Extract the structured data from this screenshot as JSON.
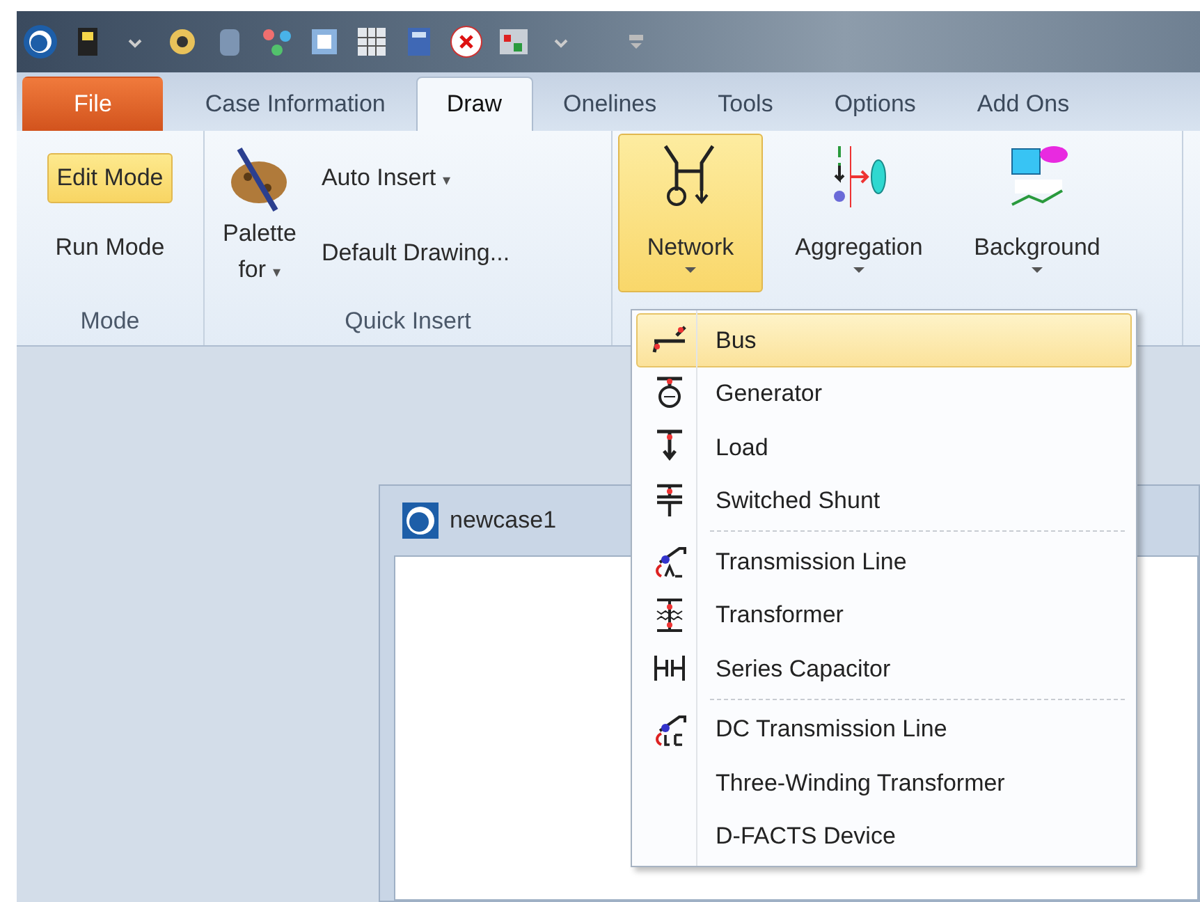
{
  "tabs": [
    {
      "label": "File",
      "kind": "file",
      "selected": false
    },
    {
      "label": "Case Information",
      "kind": "tab",
      "selected": false
    },
    {
      "label": "Draw",
      "kind": "tab",
      "selected": true
    },
    {
      "label": "Onelines",
      "kind": "tab",
      "selected": false
    },
    {
      "label": "Tools",
      "kind": "tab",
      "selected": false
    },
    {
      "label": "Options",
      "kind": "tab",
      "selected": false
    },
    {
      "label": "Add Ons",
      "kind": "tab",
      "selected": false
    }
  ],
  "ribbon": {
    "mode_group": {
      "label": "Mode",
      "buttons": [
        {
          "label": "Edit Mode",
          "selected": true
        },
        {
          "label": "Run Mode",
          "selected": false
        }
      ]
    },
    "quick_insert_group": {
      "label": "Quick Insert",
      "palette_button": {
        "label": "Palette",
        "label_2": "for",
        "caret": "▾"
      },
      "buttons": [
        {
          "label": "Auto Insert",
          "caret": "▾"
        },
        {
          "label": "Default Drawing..."
        }
      ]
    },
    "insert_group": {
      "buttons": [
        {
          "label": "Network",
          "pressed": true
        },
        {
          "label": "Aggregation",
          "pressed": false
        },
        {
          "label": "Background",
          "pressed": false
        }
      ]
    }
  },
  "document_window": {
    "title": "newcase1"
  },
  "network_menu": {
    "sections": [
      [
        {
          "label": "Bus",
          "selected": true
        },
        {
          "label": "Generator",
          "selected": false
        },
        {
          "label": "Load",
          "selected": false
        },
        {
          "label": "Switched Shunt",
          "selected": false
        }
      ],
      [
        {
          "label": "Transmission Line",
          "selected": false
        },
        {
          "label": "Transformer",
          "selected": false
        },
        {
          "label": "Series Capacitor",
          "selected": false
        }
      ],
      [
        {
          "label": "DC Transmission Line",
          "selected": false
        },
        {
          "label": "Three-Winding Transformer",
          "selected": false
        },
        {
          "label": "D-FACTS Device",
          "selected": false
        }
      ]
    ]
  }
}
